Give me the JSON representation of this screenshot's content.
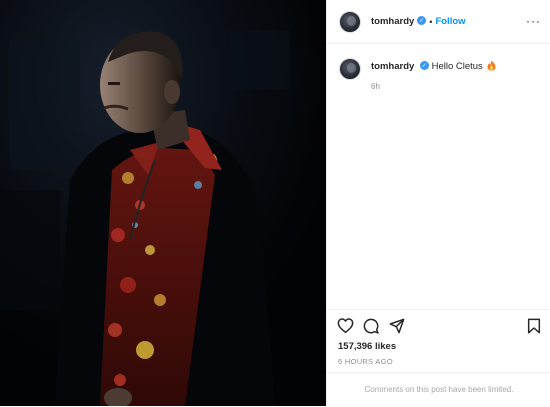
{
  "header": {
    "username": "tomhardy",
    "separator": "•",
    "follow_label": "Follow",
    "more_icon": "more-horizontal-icon"
  },
  "caption": {
    "username": "tomhardy",
    "text": "Hello Cletus",
    "emoji_icon": "flame-icon",
    "time_ago": "6h"
  },
  "actions": {
    "like_icon": "heart-icon",
    "comment_icon": "comment-icon",
    "share_icon": "share-icon",
    "save_icon": "bookmark-icon"
  },
  "stats": {
    "likes": "157,396 likes",
    "posted": "6 HOURS AGO"
  },
  "footer": {
    "comments_limited": "Comments on this post have been limited."
  },
  "colors": {
    "accent": "#0095f6",
    "verified": "#3897f0",
    "text": "#262626",
    "muted": "#8e8e8e"
  }
}
